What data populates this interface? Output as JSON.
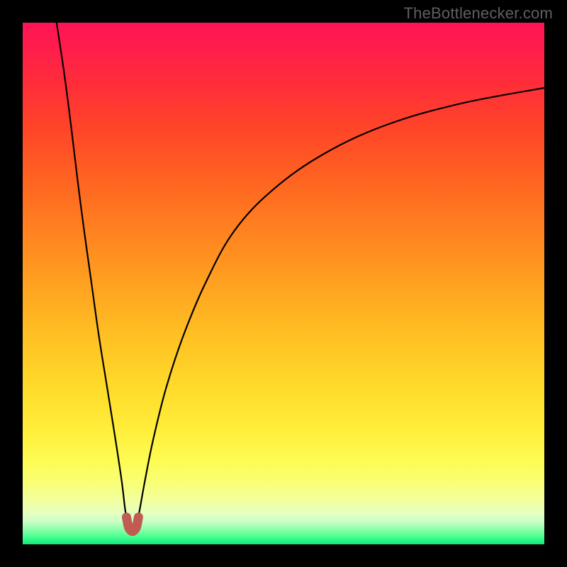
{
  "watermark": "TheBottlenecker.com",
  "gradient_stops": [
    {
      "offset": 0.0,
      "color": "#ff1455"
    },
    {
      "offset": 0.05,
      "color": "#ff1e4b"
    },
    {
      "offset": 0.12,
      "color": "#ff2e39"
    },
    {
      "offset": 0.2,
      "color": "#ff4428"
    },
    {
      "offset": 0.3,
      "color": "#ff6321"
    },
    {
      "offset": 0.4,
      "color": "#ff8220"
    },
    {
      "offset": 0.5,
      "color": "#ffa120"
    },
    {
      "offset": 0.6,
      "color": "#ffc023"
    },
    {
      "offset": 0.7,
      "color": "#ffdb2a"
    },
    {
      "offset": 0.78,
      "color": "#ffee3a"
    },
    {
      "offset": 0.84,
      "color": "#fdfc53"
    },
    {
      "offset": 0.885,
      "color": "#f9ff78"
    },
    {
      "offset": 0.915,
      "color": "#f2ff9e"
    },
    {
      "offset": 0.94,
      "color": "#e6ffbf"
    },
    {
      "offset": 0.955,
      "color": "#ccffc6"
    },
    {
      "offset": 0.968,
      "color": "#9bffb0"
    },
    {
      "offset": 0.978,
      "color": "#6eff9d"
    },
    {
      "offset": 0.988,
      "color": "#3bff8d"
    },
    {
      "offset": 1.0,
      "color": "#11e87a"
    }
  ],
  "chart_data": {
    "type": "line",
    "title": "",
    "xlabel": "",
    "ylabel": "",
    "xlim": [
      0,
      100
    ],
    "ylim": [
      0,
      100
    ],
    "curve_minimum_x": 21,
    "left_branch": [
      {
        "x": 6.5,
        "y": 100
      },
      {
        "x": 8.0,
        "y": 90
      },
      {
        "x": 9.3,
        "y": 80
      },
      {
        "x": 10.5,
        "y": 70
      },
      {
        "x": 11.8,
        "y": 60
      },
      {
        "x": 13.2,
        "y": 50
      },
      {
        "x": 14.6,
        "y": 40
      },
      {
        "x": 16.2,
        "y": 30
      },
      {
        "x": 17.8,
        "y": 20
      },
      {
        "x": 19.0,
        "y": 12
      },
      {
        "x": 19.6,
        "y": 7
      },
      {
        "x": 20.1,
        "y": 4
      },
      {
        "x": 20.6,
        "y": 2.8
      },
      {
        "x": 21.0,
        "y": 2.5
      }
    ],
    "right_branch": [
      {
        "x": 21.0,
        "y": 2.5
      },
      {
        "x": 21.4,
        "y": 2.8
      },
      {
        "x": 21.9,
        "y": 4
      },
      {
        "x": 22.5,
        "y": 7
      },
      {
        "x": 23.4,
        "y": 12
      },
      {
        "x": 25.0,
        "y": 20
      },
      {
        "x": 27.5,
        "y": 30
      },
      {
        "x": 30.8,
        "y": 40
      },
      {
        "x": 35.0,
        "y": 50
      },
      {
        "x": 40.5,
        "y": 60
      },
      {
        "x": 48.0,
        "y": 68
      },
      {
        "x": 58.0,
        "y": 75
      },
      {
        "x": 70.0,
        "y": 80.5
      },
      {
        "x": 84.0,
        "y": 84.5
      },
      {
        "x": 100.0,
        "y": 87.5
      }
    ],
    "highlight_segment": {
      "color": "#c15a52",
      "stroke_width_px": 13,
      "points": [
        {
          "x": 19.9,
          "y": 5.2
        },
        {
          "x": 20.3,
          "y": 3.3
        },
        {
          "x": 20.8,
          "y": 2.6
        },
        {
          "x": 21.3,
          "y": 2.6
        },
        {
          "x": 21.8,
          "y": 3.3
        },
        {
          "x": 22.2,
          "y": 5.2
        }
      ]
    }
  }
}
